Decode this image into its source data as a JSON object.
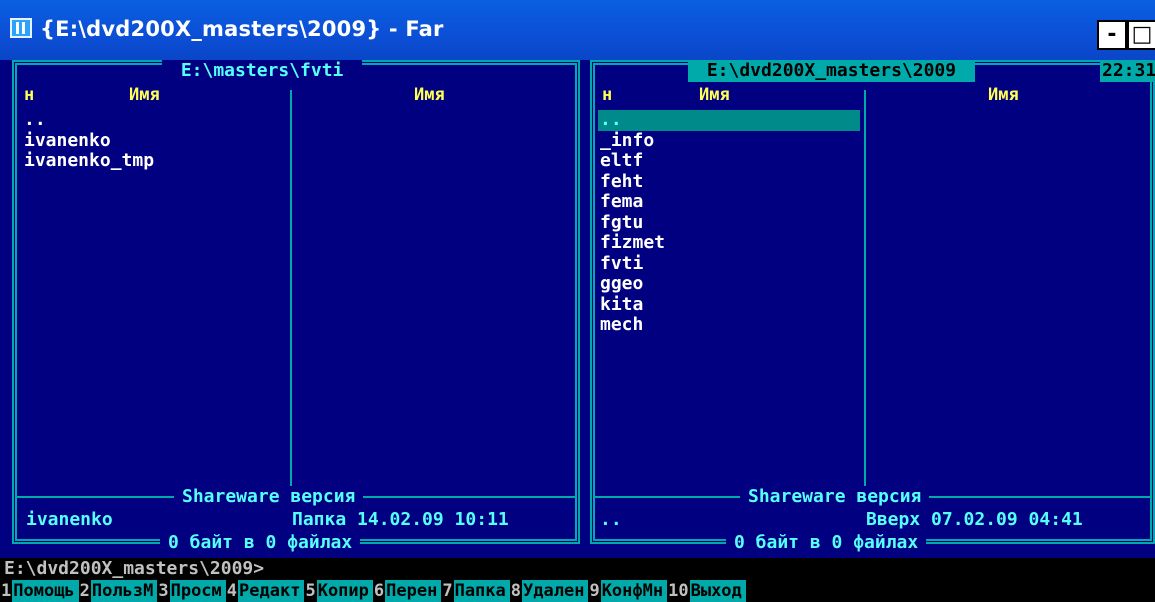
{
  "window": {
    "title": "{E:\\dvd200X_masters\\2009} - Far",
    "min_label": "-",
    "max_label": "□",
    "close_label": "×"
  },
  "left_panel": {
    "path": " E:\\masters\\fvti ",
    "col_n": "н",
    "col_name1": "Имя",
    "col_name2": "Имя",
    "files": [
      "..",
      "ivanenko",
      "ivanenko_tmp"
    ],
    "version": "Shareware версия",
    "info_name": "ivanenko",
    "info_meta": "Папка 14.02.09 10:11",
    "footer": "0 байт в 0 файлах"
  },
  "right_panel": {
    "path": " E:\\dvd200X_masters\\2009 ",
    "clock": "22:31",
    "col_n": "н",
    "col_name1": "Имя",
    "col_name2": "Имя",
    "files": [
      "..",
      "_info",
      "eltf",
      "feht",
      "fema",
      "fgtu",
      "fizmet",
      "fvti",
      "ggeo",
      "kita",
      "mech"
    ],
    "cursor_index": 0,
    "version": "Shareware версия",
    "info_name": "..",
    "info_meta": "Вверх 07.02.09 04:41",
    "footer": "0 байт в 0 файлах"
  },
  "command_line": "E:\\dvd200X_masters\\2009>",
  "keybar": [
    {
      "num": "1",
      "label": "Помощь"
    },
    {
      "num": "2",
      "label": "ПользМ"
    },
    {
      "num": "3",
      "label": "Просм"
    },
    {
      "num": "4",
      "label": "Редакт"
    },
    {
      "num": "5",
      "label": "Копир"
    },
    {
      "num": "6",
      "label": "Перен"
    },
    {
      "num": "7",
      "label": "Папка"
    },
    {
      "num": "8",
      "label": "Удален"
    },
    {
      "num": "9",
      "label": "КонфМн"
    },
    {
      "num": "10",
      "label": "Выход"
    }
  ],
  "colors": {
    "console_bg": "#000080",
    "frame": "#00aaaa",
    "text": "#ffffff",
    "header": "#ffff55",
    "cursor_bg": "#008a8a",
    "titlebar": "#0b4fd6"
  },
  "icons": {
    "app": "far-manager-icon"
  }
}
